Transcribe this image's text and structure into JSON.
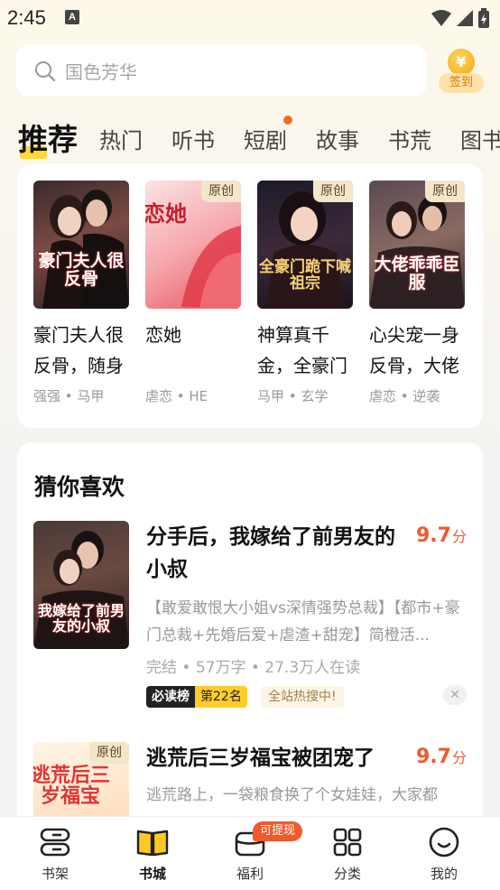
{
  "status": {
    "time": "2:45",
    "notif_letter": "A"
  },
  "search": {
    "placeholder": "国色芳华"
  },
  "checkin": {
    "coin": "¥",
    "label": "签到"
  },
  "tabs": [
    "推荐",
    "热门",
    "听书",
    "短剧",
    "故事",
    "书荒",
    "图书"
  ],
  "recommend": [
    {
      "title": "豪门夫人很反骨，随身",
      "tags": "强强 • 马甲",
      "original": false,
      "cover_text": "豪门夫人很反骨"
    },
    {
      "title": "恋她",
      "tags": "虐恋 • HE",
      "original": true,
      "badge": "原创",
      "cover_text": "恋她"
    },
    {
      "title": "神算真千金，全豪门",
      "tags": "马甲 • 玄学",
      "original": true,
      "badge": "原创",
      "cover_text": "全豪门跪下喊祖宗"
    },
    {
      "title": "心尖宠一身反骨，大佬",
      "tags": "虐恋 • 逆袭",
      "original": true,
      "badge": "原创",
      "cover_text": "大佬乖乖臣服"
    }
  ],
  "guess": {
    "heading": "猜你喜欢",
    "items": [
      {
        "title": "分手后，我嫁给了前男友的小叔",
        "score": "9.7",
        "score_unit": "分",
        "desc": "【敢爱敢恨大小姐vs深情强势总裁】【都市+豪门总裁+先婚后爱+虐渣+甜宠】简橙活...",
        "meta": "完结 • 57万字 • 27.3万人在读",
        "rank_label": "必读榜",
        "rank_value": "第22名",
        "hot": "全站热搜中!",
        "cover_text": "我嫁给了前男友的小叔"
      },
      {
        "title": "逃荒后三岁福宝被团宠了",
        "score": "9.7",
        "score_unit": "分",
        "desc": "逃荒路上，一袋粮食换了个女娃娃，大家都",
        "badge": "原创",
        "cover_text": "逃荒后三岁福宝"
      }
    ]
  },
  "nav": [
    {
      "label": "书架",
      "icon": "bookshelf-icon"
    },
    {
      "label": "书城",
      "icon": "bookstore-icon",
      "active": true
    },
    {
      "label": "福利",
      "icon": "gift-icon",
      "badge": "可提现"
    },
    {
      "label": "分类",
      "icon": "category-icon"
    },
    {
      "label": "我的",
      "icon": "profile-icon"
    }
  ],
  "colors": {
    "accent": "#f25a2b",
    "tab_underline": "#ffd93a",
    "score": "#f25a2b"
  }
}
